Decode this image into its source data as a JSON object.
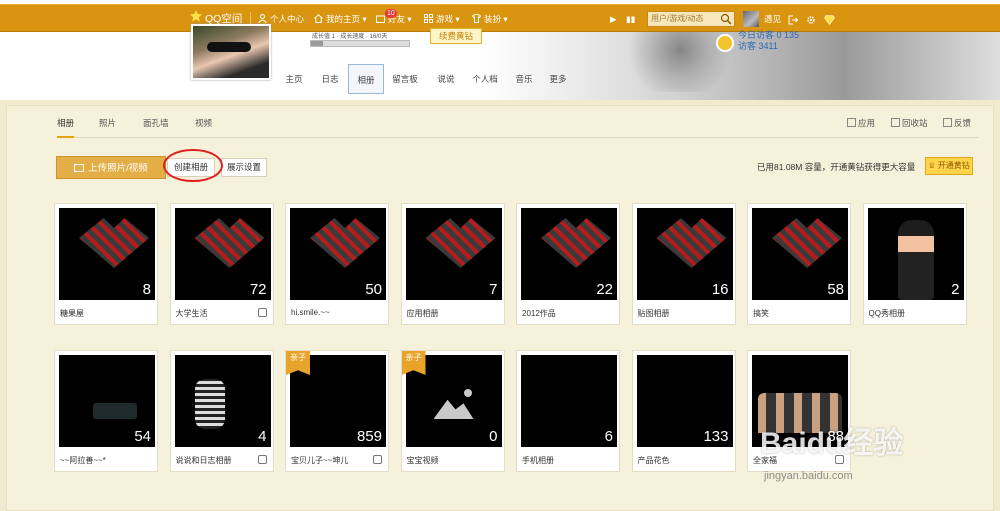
{
  "topbar": {
    "logo": "QQ空间",
    "personal_center": "个人中心",
    "my_home": "我的主页",
    "friends": "好友",
    "friends_badge": "10",
    "games": "游戏",
    "dressup": "装扮",
    "search_placeholder": "用户/游戏/动态",
    "username": "遇见"
  },
  "profile": {
    "level_text": "成长值 1 · 成长速度 · 16/0天",
    "level_progress": 0.12,
    "renew_label": "续费黄钻",
    "today_visits": "今日访客 0",
    "total_visits": "访客 3411",
    "visits_extra": "135"
  },
  "nav": [
    "主页",
    "日志",
    "相册",
    "留言板",
    "说说",
    "个人档",
    "音乐",
    "更多"
  ],
  "nav_active": "相册",
  "tabs": [
    "相册",
    "照片",
    "面孔墙",
    "视频"
  ],
  "tabs_active": "相册",
  "right_links": [
    "应用",
    "回收站",
    "反馈"
  ],
  "toolbar": {
    "upload_label": "上传照片/视频",
    "create_album_label": "创建相册",
    "display_settings_label": "展示设置",
    "capacity_text": "已用81.08M 容量，开通黄钻获得更大容量",
    "vip_label": "开通黄钻"
  },
  "albums_row1": [
    {
      "name": "糖果屋",
      "count": "8",
      "thumb": "heart"
    },
    {
      "name": "大学生活",
      "count": "72",
      "thumb": "heart"
    },
    {
      "name": "hi.smile.~~",
      "count": "50",
      "thumb": "heart"
    },
    {
      "name": "应用相册",
      "count": "7",
      "thumb": "heart"
    },
    {
      "name": "2012作品",
      "count": "22",
      "thumb": "heart"
    },
    {
      "name": "贴图相册",
      "count": "16",
      "thumb": "heart"
    },
    {
      "name": "搞笑",
      "count": "58",
      "thumb": "heart"
    },
    {
      "name": "QQ秀相册",
      "count": "2",
      "thumb": "qq"
    }
  ],
  "albums_row2": [
    {
      "name": "~~阿拉善~~*",
      "count": "54",
      "thumb": "car"
    },
    {
      "name": "说说和日志相册",
      "count": "4",
      "thumb": "kid"
    },
    {
      "name": "宝贝儿子~~坤儿",
      "count": "859",
      "thumb": "room",
      "tag": "亲子"
    },
    {
      "name": "宝宝视频",
      "count": "0",
      "thumb": "empty",
      "tag": "亲子"
    },
    {
      "name": "手机相册",
      "count": "6",
      "thumb": "baby"
    },
    {
      "name": "产品花色",
      "count": "133",
      "thumb": "plate"
    },
    {
      "name": "全家福",
      "count": "88",
      "thumb": "family"
    }
  ],
  "watermark": {
    "brand": "Baidu经验",
    "url": "jingyan.baidu.com"
  },
  "colors": {
    "topbar": "#d99410",
    "panel_bg": "#f6f1da",
    "highlight": "#e02020",
    "upload": "#e3ae45"
  }
}
